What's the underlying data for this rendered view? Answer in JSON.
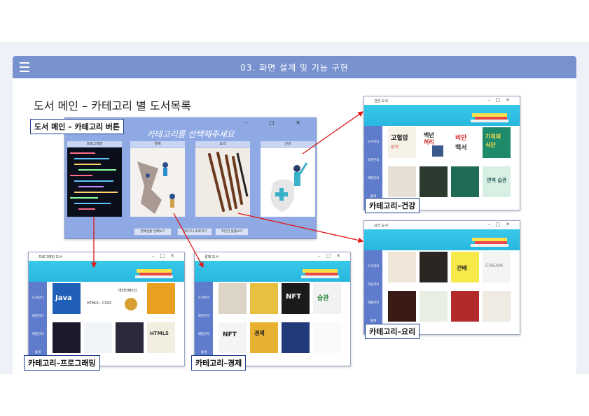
{
  "header": {
    "title": "03. 화면 설계 및 기능 구현"
  },
  "page": {
    "heading": "도서 메인 – 카테고리 별 도서목록"
  },
  "labels": {
    "main": "도서 메인 – 카테고리 버튼",
    "health": "카테고리–건강",
    "cooking": "카테고리–요리",
    "programming": "카테고리–프로그래밍",
    "economy": "카테고리–경제"
  },
  "main_window": {
    "prompt": "카테고리를 선택해주세요",
    "controls": "–  □  ✕",
    "categories": [
      "프로그래밍",
      "경제",
      "요리",
      "건강"
    ],
    "buttons": [
      "판매상품 전체보기",
      "장바구니 바로가기",
      "주문한 물품보기"
    ]
  },
  "health_window": {
    "title": "건강 도서",
    "side": [
      "도서관리",
      "회원관리",
      "매출관리",
      "통계"
    ]
  },
  "cooking_window": {
    "title": "요리 도서",
    "side": [
      "도서관리",
      "회원관리",
      "매출관리",
      "통계"
    ]
  },
  "programming_window": {
    "title": "프로그래밍 도서",
    "side": [
      "도서관리",
      "회원관리",
      "매출관리",
      "통계"
    ]
  },
  "economy_window": {
    "title": "경제 도서",
    "side": [
      "도서관리",
      "회원관리",
      "매출관리",
      "통계"
    ]
  },
  "colors": {
    "header": "#7891cf",
    "arrow": "#e01818",
    "label_border": "#1c3d8f",
    "banner": "#38c8e8",
    "side": "#5f7ccc"
  }
}
